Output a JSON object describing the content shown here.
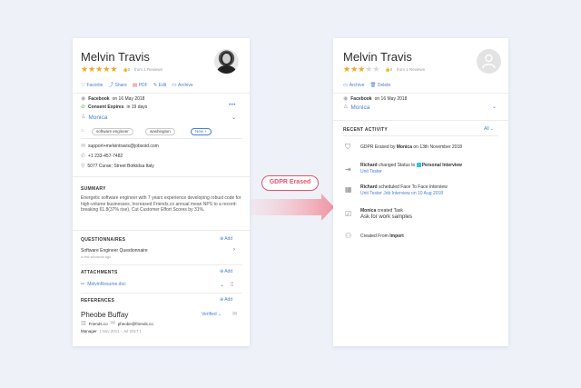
{
  "left": {
    "name": "Melvin Travis",
    "rating": 5,
    "likes": "0",
    "reviews": "from 1 Reviews",
    "actions": [
      {
        "icon": "heart-icon",
        "glyph": "♡",
        "label": "Favorite"
      },
      {
        "icon": "share-icon",
        "glyph": "⤴",
        "label": "Share"
      },
      {
        "icon": "pdf-icon",
        "glyph": "▤",
        "label": "PDF"
      },
      {
        "icon": "edit-icon",
        "glyph": "✎",
        "label": "Edit"
      },
      {
        "icon": "archive-icon",
        "glyph": "▭",
        "label": "Archive"
      }
    ],
    "source_label": "Facebook",
    "source_date": "on 16 May 2018",
    "consent_label": "Consent Expires",
    "consent_value": "in 19 days",
    "owner": "Monica",
    "tags": [
      "software engineer",
      "washington"
    ],
    "tag_new": "New +",
    "email": "support+melvintravis@jobsoid.com",
    "phone": "+1 233-457-7482",
    "address": "5077 Curae; Street Botkidsa Italy",
    "summary_title": "SUMMARY",
    "summary": "Energetic software engineer with 7 years experience developing robust code for high-volume businesses. Increased Friends.co annual mean NPS to a record-breaking 61.8(37% rise). Cut Customer Effort Scores by 31%.",
    "questionnaires_title": "QUESTIONNAIRES",
    "add_label": "Add",
    "questionnaire_name": "Software Engineer Questionnaire",
    "questionnaire_time": "a few seconds ago",
    "attachments_title": "ATTACHMENTS",
    "attachment_name": "MelvinResume.doc",
    "references_title": "REFERENCES",
    "ref_name": "Pheobe Buffay",
    "ref_verified": "Verified",
    "ref_company": "Friends.co",
    "ref_email": "pheobe@friends.co",
    "ref_role": "Manager",
    "ref_period": "( Nov 2011 - Jul 2017 )"
  },
  "badge": "GDPR Erased",
  "right": {
    "name": "Melvin Travis",
    "rating": 3,
    "likes": "0",
    "reviews": "from 1 Reviews",
    "actions": [
      {
        "icon": "archive-icon",
        "glyph": "▭",
        "label": "Archive"
      },
      {
        "icon": "trash-icon",
        "glyph": "🗑",
        "label": "Delete"
      }
    ],
    "source_label": "Facebook",
    "source_date": "on 16 May 2018",
    "owner": "Monica",
    "recent_title": "RECENT ACTIVITY",
    "filter": "All",
    "activities": [
      {
        "icon": "shield-icon",
        "glyph": "⛉",
        "prefix": "GDPR Erased by ",
        "actor": "Monica",
        "suffix": " on 13th November 2018",
        "link": ""
      },
      {
        "icon": "status-change-icon",
        "glyph": "⇥",
        "prefix": "",
        "actor": "Richard",
        "suffix": " changed Status to ",
        "status": "Personal Interview",
        "link": "Unit Tester"
      },
      {
        "icon": "calendar-icon",
        "glyph": "▦",
        "prefix": "",
        "actor": "Richard",
        "suffix": " scheduled Face To Face Interview",
        "link": "Unit Tester Job Interview on 10 Aug 2018"
      },
      {
        "icon": "task-icon",
        "glyph": "☑",
        "prefix": "",
        "actor": "Monica",
        "suffix": " created Task",
        "sub": "Ask for work samples"
      },
      {
        "icon": "import-user-icon",
        "glyph": "⚇",
        "prefix": "Created From ",
        "actor": "Import",
        "suffix": ""
      }
    ]
  }
}
